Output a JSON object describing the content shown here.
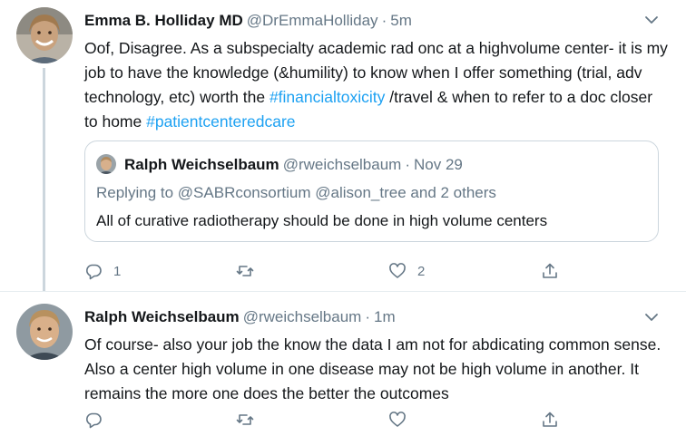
{
  "tweets": [
    {
      "author": {
        "name": "Emma B. Holliday MD",
        "handle": "@DrEmmaHolliday"
      },
      "time": "5m",
      "separator": "·",
      "text_parts": [
        "Oof, Disagree. As a subspecialty academic rad onc at a highvolume center- it is my job to have the knowledge (&humility) to know when I offer something (trial, adv technology, etc) worth the ",
        "#financialtoxicity",
        " /travel & when to refer to a doc closer to home ",
        "#patientcenteredcare"
      ],
      "quoted": {
        "author": {
          "name": "Ralph Weichselbaum",
          "handle": "@rweichselbaum"
        },
        "separator": "·",
        "time": "Nov 29",
        "replying_prefix": "Replying to",
        "replying_to": [
          "@SABRconsortium",
          "@alison_tree"
        ],
        "replying_suffix": "and 2 others",
        "text": "All of curative radiotherapy should be done in high volume centers"
      },
      "actions": {
        "reply_count": "1",
        "retweet_count": "",
        "like_count": "2"
      },
      "icons": {
        "reply": "reply-icon",
        "retweet": "retweet-icon",
        "like": "heart-icon",
        "share": "share-icon",
        "more": "chevron-down-icon"
      }
    },
    {
      "author": {
        "name": "Ralph Weichselbaum",
        "handle": "@rweichselbaum"
      },
      "time": "1m",
      "separator": "·",
      "text": "Of course- also your job the know the data  I am not for abdicating common sense. Also a center high volume in one disease may not be high volume in another. It remains the more one does the better the outcomes",
      "actions": {
        "reply_count": "",
        "retweet_count": "",
        "like_count": ""
      },
      "icons": {
        "reply": "reply-icon",
        "retweet": "retweet-icon",
        "like": "heart-icon",
        "share": "share-icon",
        "more": "chevron-down-icon"
      }
    }
  ],
  "colors": {
    "link": "#1da1f2",
    "secondary": "#657786",
    "border": "#ccd6dd",
    "text": "#14171a"
  }
}
